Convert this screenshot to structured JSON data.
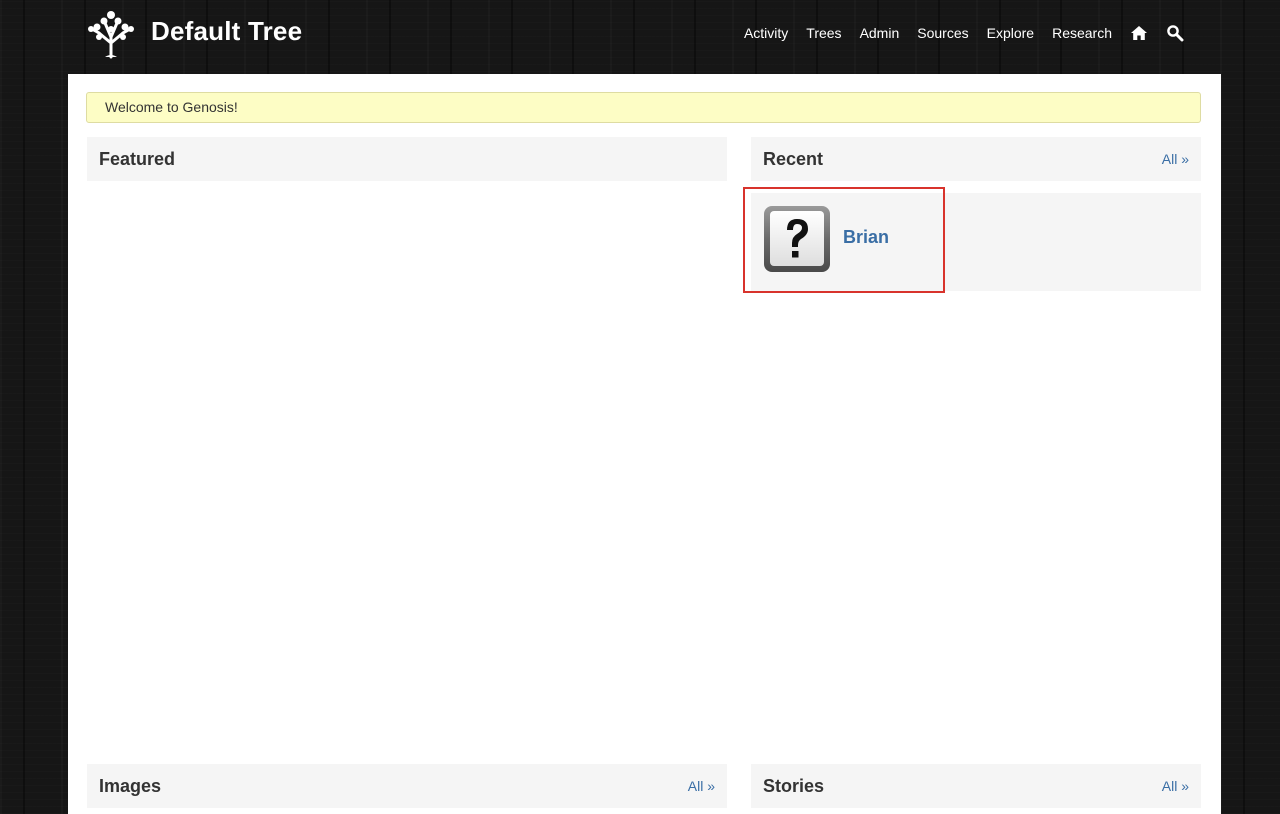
{
  "header": {
    "site_title": "Default Tree",
    "nav": [
      {
        "label": "Activity"
      },
      {
        "label": "Trees"
      },
      {
        "label": "Admin"
      },
      {
        "label": "Sources"
      },
      {
        "label": "Explore"
      },
      {
        "label": "Research"
      }
    ],
    "icons": {
      "home": "home-icon",
      "search": "search-icon",
      "logo": "tree-logo-icon"
    }
  },
  "welcome_message": "Welcome to Genosis!",
  "panels": {
    "featured": {
      "title": "Featured"
    },
    "recent": {
      "title": "Recent",
      "all_link": "All »",
      "items": [
        {
          "name": "Brian",
          "avatar": "unknown-person-question-icon"
        }
      ]
    },
    "images": {
      "title": "Images",
      "all_link": "All »"
    },
    "stories": {
      "title": "Stories",
      "all_link": "All »"
    }
  },
  "colors": {
    "link": "#3a6ea5",
    "welcome_bg": "#fdfdc5",
    "highlight": "#d8332c",
    "panel_bg": "#f5f5f5"
  }
}
